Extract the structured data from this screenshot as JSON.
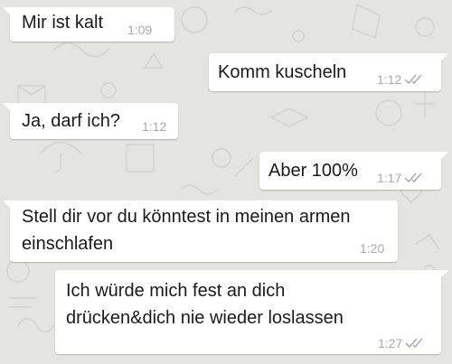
{
  "colors": {
    "background": "#e4e4e2",
    "bubble": "#ffffff",
    "text": "#1a1a1a",
    "timestamp": "#a9a9a9",
    "read_ticks": "#a9a9a9"
  },
  "messages": [
    {
      "direction": "incoming",
      "text": "Mir ist kalt",
      "time": "1:09"
    },
    {
      "direction": "outgoing",
      "text": "Komm kuscheln",
      "time": "1:12",
      "status_icon": "double-check-icon"
    },
    {
      "direction": "incoming",
      "text": "Ja, darf ich?",
      "time": "1:12"
    },
    {
      "direction": "outgoing",
      "text": "Aber 100%",
      "time": "1:17",
      "status_icon": "double-check-icon"
    },
    {
      "direction": "incoming",
      "text": "Stell dir vor du könntest in meinen armen\neinschlafen",
      "time": "1:20"
    },
    {
      "direction": "outgoing",
      "text": "Ich würde mich fest an dich\ndrücken&dich nie wieder loslassen",
      "time": "1:27",
      "status_icon": "double-check-icon"
    }
  ]
}
